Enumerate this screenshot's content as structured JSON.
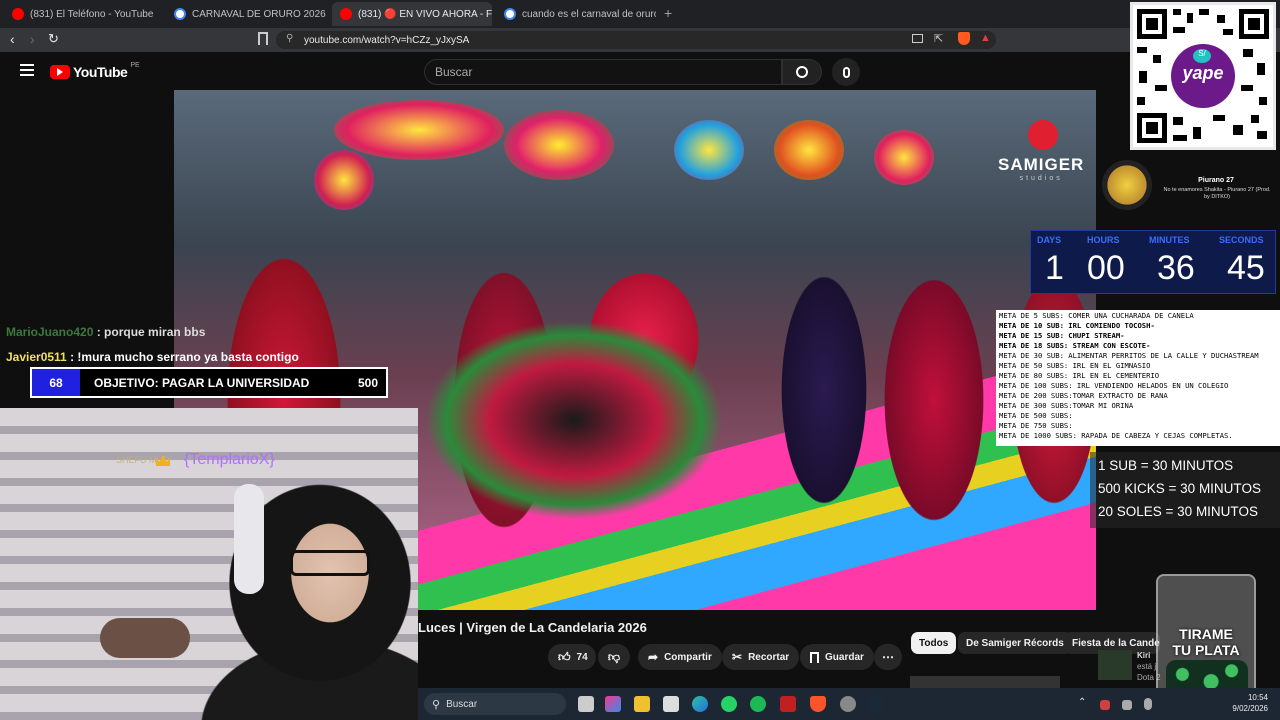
{
  "browser": {
    "tabs": [
      {
        "label": "(831) El Teléfono - YouTube",
        "active": false
      },
      {
        "label": "CARNAVAL DE ORURO 2026 CUAND",
        "active": false
      },
      {
        "label": "(831) 🔴 EN VIVO AHORA - F",
        "active": true
      },
      {
        "label": "cuando es el carnaval de oruro 2026",
        "active": false
      }
    ],
    "url": "youtube.com/watch?v=hCZz_yJxySA"
  },
  "youtube": {
    "logo": "YouTube",
    "region": "PE",
    "search_placeholder": "Buscar"
  },
  "video": {
    "watermark": "SAMIGER",
    "watermark_sub": "studios"
  },
  "music": {
    "title": "Piurano 27",
    "subtitle": "No te enamores Shakita - Piurano 27 (Prod. by DITKO)"
  },
  "countdown": {
    "labels": [
      "DAYS",
      "HOURS",
      "MINUTES",
      "SECONDS"
    ],
    "values": [
      "1",
      "00",
      "36",
      "45"
    ]
  },
  "metas": [
    {
      "text": "META DE 5 SUBS: COMER UNA CUCHARADA DE CANELA",
      "bold": false
    },
    {
      "text": "META DE 10 SUB: IRL COMIENDO TOCOSH-",
      "bold": true
    },
    {
      "text": "META DE 15 SUB: CHUPI STREAM-",
      "bold": true
    },
    {
      "text": "META DE 18 SUBS: STREAM CON ESCOTE-",
      "bold": true
    },
    {
      "text": "META DE 30 SUB:  ALIMENTAR PERRITOS DE LA CALLE Y DUCHASTREAM",
      "bold": false
    },
    {
      "text": "META DE 50 SUBS: IRL EN EL GIMNASIO",
      "bold": false
    },
    {
      "text": "META DE 80 SUBS: IRL EN EL CEMENTERIO",
      "bold": false
    },
    {
      "text": "META DE 100 SUBS: IRL VENDIENDO HELADOS EN UN COLEGIO",
      "bold": false
    },
    {
      "text": "META DE 200 SUBS:TOMAR EXTRACTO DE RANA",
      "bold": false
    },
    {
      "text": "META DE 300 SUBS:TOMAR MI ORINA",
      "bold": false
    },
    {
      "text": "META DE 500 SUBS:",
      "bold": false
    },
    {
      "text": "META DE 750 SUBS:",
      "bold": false
    },
    {
      "text": "META DE 1000 SUBS: RAPADA DE CABEZA Y CEJAS COMPLETAS.",
      "bold": false
    }
  ],
  "rates": [
    "1 SUB = 30 MINUTOS",
    "500 KICKS = 30 MINUTOS",
    "20 SOLES = 30 MINUTOS"
  ],
  "chat": [
    {
      "user": "MarioJuano420",
      "message": " : porque miran bbs"
    },
    {
      "user": "Javier0511",
      "message": " : !mura mucho serrano ya basta contigo"
    }
  ],
  "goal": {
    "current": "68",
    "label": "OBJETIVO: PAGAR LA UNIVERSIDAD",
    "target": "500",
    "progress": 0.136
  },
  "alert": {
    "username": "{TemplarioX}",
    "tag": "SHEFU MUD"
  },
  "below": {
    "title": "Luces | Virgen de La Candelaria 2026",
    "likes": "74",
    "share": "Compartir",
    "clip": "Recortar",
    "save": "Guardar",
    "chips": [
      "Todos",
      "De Samiger Récords",
      "Fiesta de la Candela"
    ],
    "side_item": {
      "title": "Kiri",
      "line2": "está j",
      "line3": "Dota 2"
    }
  },
  "jar": {
    "line1": "TIRAME",
    "line2": "TU PLATA"
  },
  "qr_label": "yape",
  "taskbar": {
    "search": "Buscar",
    "time": "10:54",
    "date": "9/02/2026"
  },
  "colors": {
    "goal_fill": "#2020e0",
    "youtube_red": "#ff0000",
    "countdown_blue": "#3a6cff",
    "jar_text": "#ffffff"
  }
}
